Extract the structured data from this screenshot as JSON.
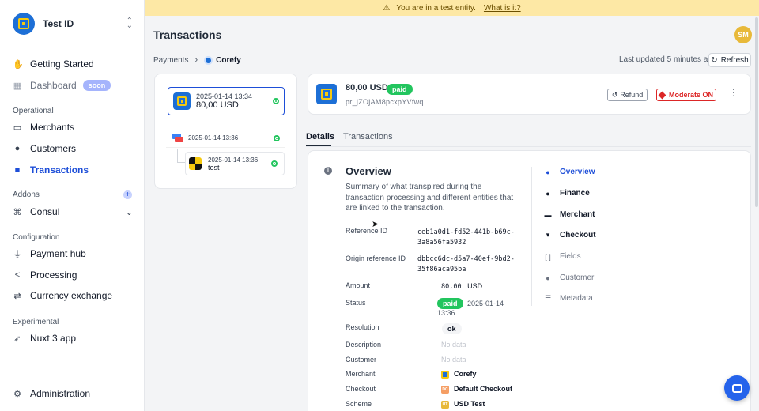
{
  "org": {
    "name": "Test ID"
  },
  "nav": {
    "getting_started": "Getting Started",
    "dashboard": "Dashboard",
    "soon_badge": "soon",
    "sec_operational": "Operational",
    "merchants": "Merchants",
    "customers": "Customers",
    "transactions": "Transactions",
    "sec_addons": "Addons",
    "consul": "Consul",
    "sec_configuration": "Configuration",
    "payment_hub": "Payment hub",
    "processing": "Processing",
    "currency_exchange": "Currency exchange",
    "sec_experimental": "Experimental",
    "nuxt": "Nuxt 3 app",
    "administration": "Administration"
  },
  "banner": {
    "text": "You are in a test entity.",
    "link": "What is it?"
  },
  "header": {
    "title": "Transactions",
    "avatar": "SM"
  },
  "breadcrumb": {
    "root": "Payments",
    "current": "Corefy"
  },
  "toolbar": {
    "updated": "Last updated 5 minutes ago",
    "refresh": "Refresh"
  },
  "tree": {
    "main": {
      "date": "2025-01-14 13:34",
      "amount": "80,00 USD"
    },
    "child": {
      "date": "2025-01-14 13:36"
    },
    "grandchild": {
      "date": "2025-01-14 13:36",
      "name": "test"
    }
  },
  "summary": {
    "amount": "80,00 USD",
    "status": "paid",
    "id": "pr_jZOjAM8pcxpYVfwq",
    "refund": "Refund",
    "moderate": "Moderate ON"
  },
  "tabs": {
    "details": "Details",
    "transactions": "Transactions"
  },
  "overview": {
    "title": "Overview",
    "desc": "Summary of what transpired during the transaction processing and different entities that are linked to the transaction.",
    "labels": {
      "reference_id": "Reference ID",
      "origin_reference_id": "Origin reference ID",
      "amount": "Amount",
      "status": "Status",
      "resolution": "Resolution",
      "description": "Description",
      "customer": "Customer",
      "merchant": "Merchant",
      "checkout": "Checkout",
      "scheme": "Scheme"
    },
    "values": {
      "reference_id_1": "ceb1a0d1-fd52-441b-b69c-",
      "reference_id_2": "3a8a56fa5932",
      "origin_reference_id_1": "dbbcc6dc-d5a7-40ef-9bd2-",
      "origin_reference_id_2": "35f86aca95ba",
      "amount": "80,00",
      "currency": "USD",
      "status_pill": "paid",
      "status_date_1": "2025-01-14",
      "status_date_2": "13:36",
      "resolution": "ok",
      "description": "No data",
      "customer": "No data",
      "merchant": "Corefy",
      "checkout": "Default Checkout",
      "checkout_badge": "DC",
      "scheme": "USD Test",
      "scheme_badge": "UT"
    }
  },
  "sections_nav": [
    "Overview",
    "Finance",
    "Merchant",
    "Checkout",
    "Fields",
    "Customer",
    "Metadata"
  ],
  "colors": {
    "accent": "#1d4ed8",
    "success": "#22c55e",
    "danger": "#dc2626",
    "banner": "#fde8a5"
  }
}
